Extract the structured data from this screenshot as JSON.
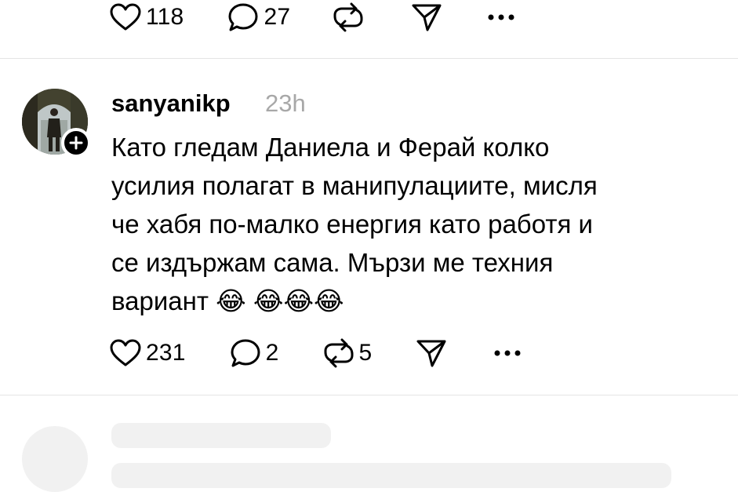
{
  "prev_post": {
    "likes": "118",
    "replies": "27",
    "reposts": "",
    "icons": [
      "heart-icon",
      "comment-icon",
      "repost-icon",
      "share-icon",
      "more-icon"
    ]
  },
  "post": {
    "username": "sanyanikp",
    "time": "23h",
    "text": "Като гледам Даниела и Ферай колко\nусилия полагат в манипулациите, мисля\nче хабя по-малко енергия като работя и\nсе издържам сама. Мързи ме техния\nвариант 😂 😂😂😂",
    "likes": "231",
    "replies": "2",
    "reposts": "5",
    "icons": [
      "heart-icon",
      "comment-icon",
      "repost-icon",
      "share-icon",
      "more-icon"
    ]
  },
  "colors": {
    "text": "#000000",
    "muted": "#a8a8a8",
    "divider": "#e4e4e4",
    "skeleton": "#f1f1f1"
  }
}
